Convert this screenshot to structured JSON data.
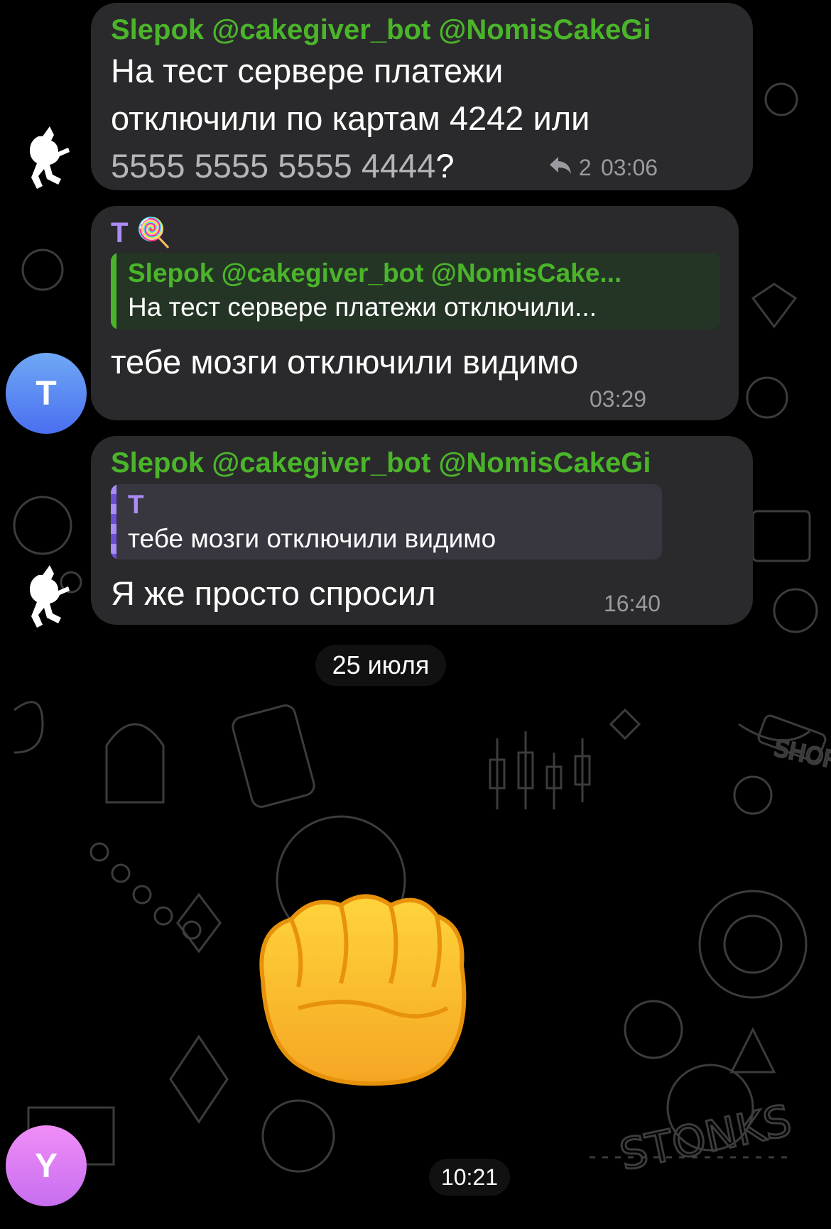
{
  "messages": [
    {
      "sender": "Slepok @cakegiver_bot @NomisCakeGi...",
      "text_line1": "На тест сервере платежи",
      "text_line2": "отключили по картам 4242 или",
      "text_card": "5555 5555 5555 4444",
      "text_tail": "?",
      "replies_count": "2",
      "time": "03:06"
    },
    {
      "sender": "T",
      "sender_emoji": "🍭",
      "quote_name": "Slepok @cakegiver_bot @NomisCake...",
      "quote_text": "На тест сервере платежи отключили...",
      "text": "тебе мозги отключили видимо",
      "time": "03:29",
      "avatar_letter": "T"
    },
    {
      "sender": "Slepok @cakegiver_bot @NomisCakeGi...",
      "quote_name": "T",
      "quote_text": "тебе мозги отключили видимо",
      "text": "Я же просто спросил",
      "time": "16:40"
    }
  ],
  "date_separator": "25 июля",
  "sticker": {
    "icon": "fist-emoji-sticker",
    "time": "10:21",
    "avatar_letter": "Y"
  },
  "colors": {
    "bubble": "#2a2a2c",
    "sender_green": "#4bb52a",
    "sender_purple": "#a98cf5",
    "quote_green_bg": "#243526",
    "quote_purple_bg": "#38363f"
  }
}
